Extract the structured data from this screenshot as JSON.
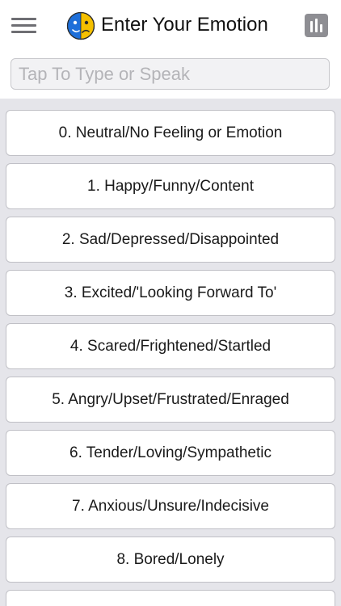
{
  "header": {
    "title": "Enter Your Emotion",
    "menu_icon": "hamburger-menu-icon",
    "logo_icon": "two-face-emotion-logo",
    "chart_icon": "bar-chart-icon"
  },
  "search": {
    "placeholder": "Tap To Type or Speak",
    "value": ""
  },
  "emotions": [
    "0. Neutral/No Feeling or Emotion",
    "1. Happy/Funny/Content",
    "2. Sad/Depressed/Disappointed",
    "3. Excited/'Looking Forward To'",
    "4. Scared/Frightened/Startled",
    "5. Angry/Upset/Frustrated/Enraged",
    "6. Tender/Loving/Sympathetic",
    "7. Anxious/Unsure/Indecisive",
    "8. Bored/Lonely",
    ""
  ],
  "colors": {
    "logo_left": "#1e6fd9",
    "logo_right": "#f5c000",
    "icon_gray": "#8e8e93",
    "list_background": "#e5e5ea"
  }
}
